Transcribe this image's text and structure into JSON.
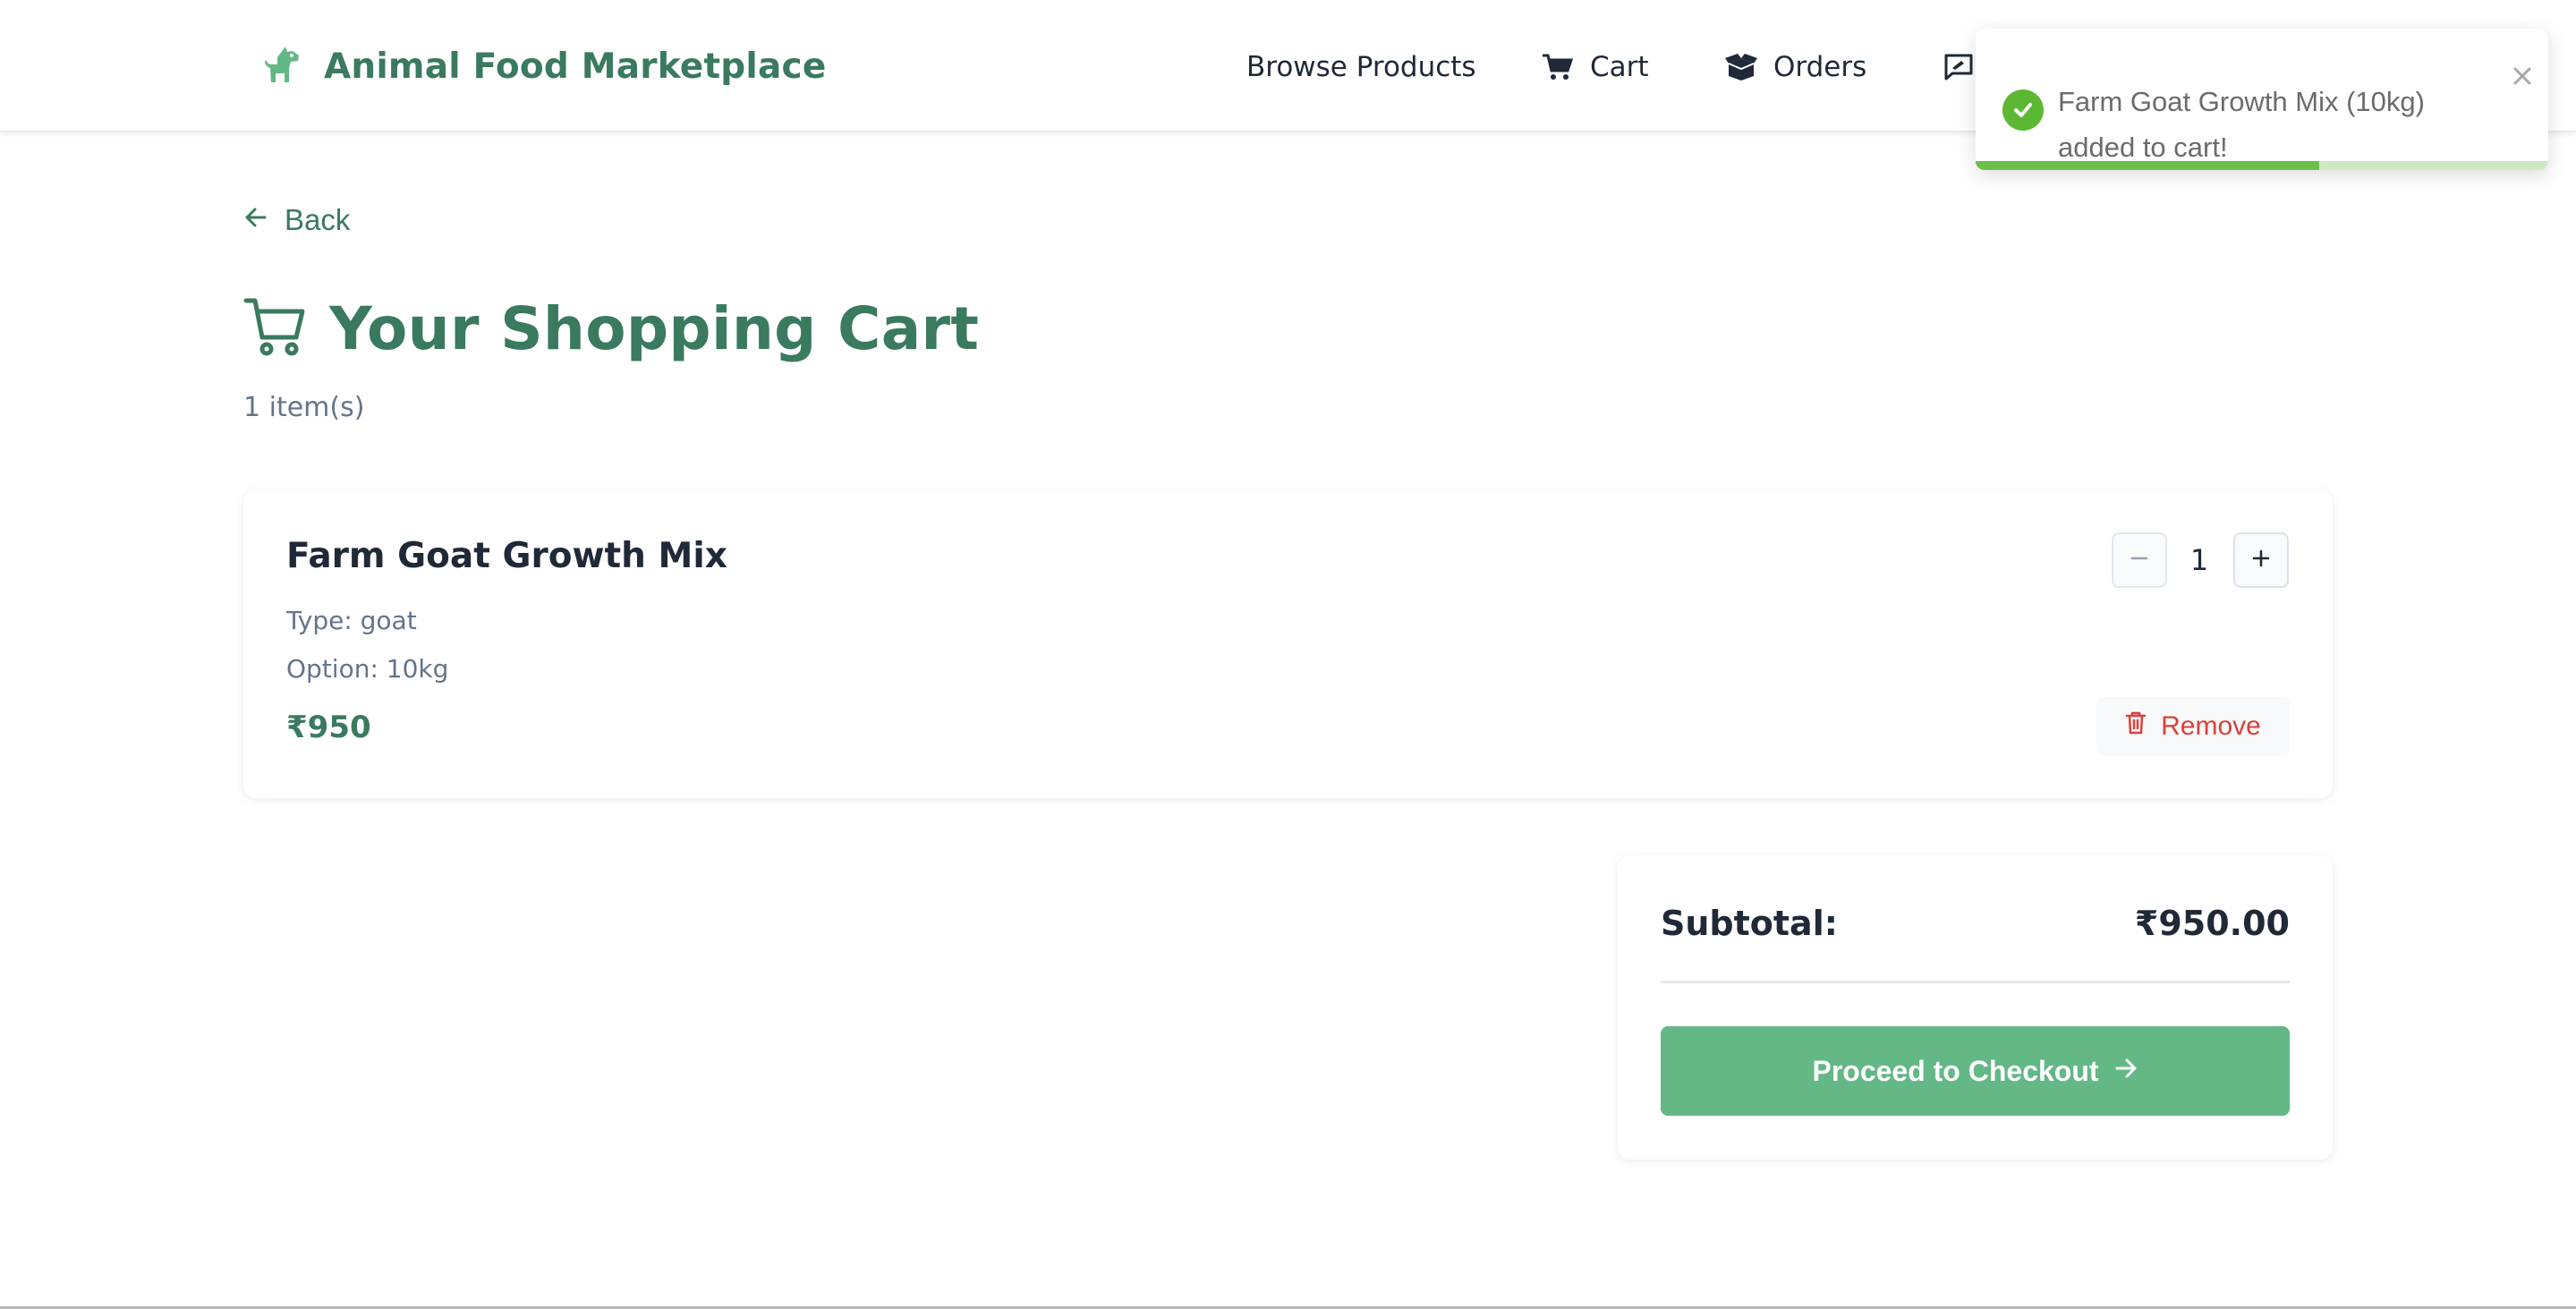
{
  "header": {
    "brand_name": "Animal Food Marketplace",
    "brand_icon": "dog-icon",
    "nav": [
      {
        "label": "Browse Products",
        "icon": ""
      },
      {
        "label": "Cart",
        "icon": "shopping-cart-icon"
      },
      {
        "label": "Orders",
        "icon": "box-open-icon"
      },
      {
        "label": "",
        "icon": "feedback-icon"
      }
    ]
  },
  "toast": {
    "message": "Farm Goat Growth Mix (10kg) added to cart!",
    "progress": 0.6,
    "icon": "check-circle-icon"
  },
  "back_label": "Back",
  "page": {
    "title": "Your Shopping Cart",
    "item_count": "1 item(s)"
  },
  "cart": {
    "items": [
      {
        "name": "Farm Goat Growth Mix",
        "type": "Type: goat",
        "option": "Option: 10kg",
        "price": "₹950",
        "quantity": "1",
        "remove_label": "Remove"
      }
    ]
  },
  "summary": {
    "subtotal_label": "Subtotal:",
    "subtotal_value": "₹950.00",
    "checkout_label": "Proceed to Checkout"
  },
  "colors": {
    "brand_green": "#3a7a5e",
    "button_green": "#63b886",
    "toast_green": "#5cb833",
    "danger_red": "#d9413a"
  }
}
